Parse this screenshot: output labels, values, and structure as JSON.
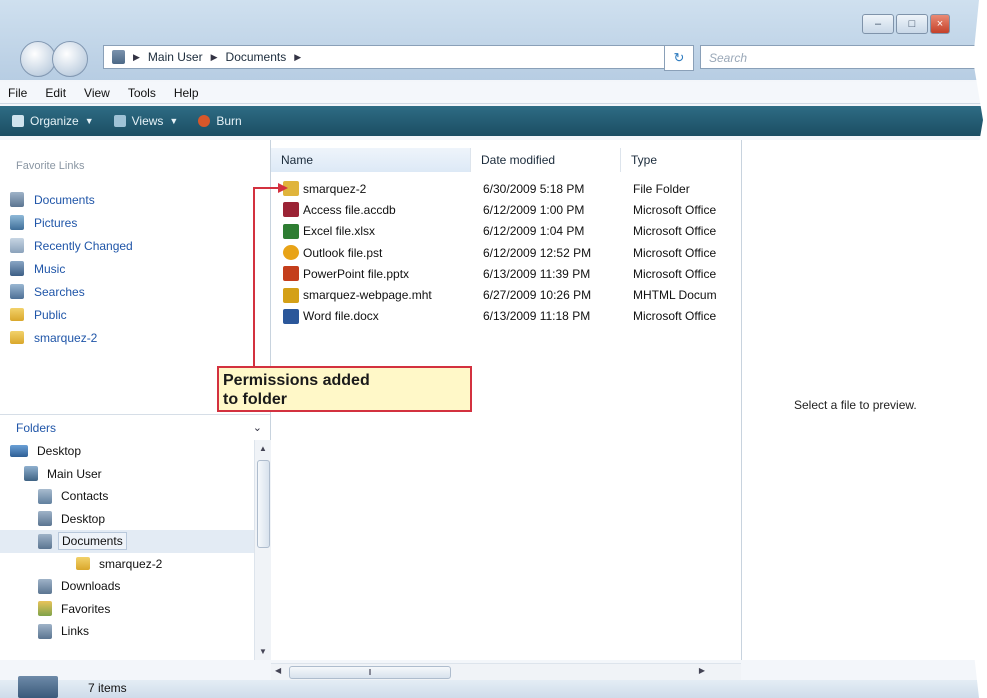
{
  "window": {
    "caption_buttons": [
      "minimize",
      "maximize",
      "close"
    ]
  },
  "address_bar": {
    "crumbs": [
      "Main User",
      "Documents"
    ]
  },
  "search": {
    "placeholder": "Search"
  },
  "menu": [
    "File",
    "Edit",
    "View",
    "Tools",
    "Help"
  ],
  "toolbar": {
    "organize": "Organize",
    "views": "Views",
    "burn": "Burn"
  },
  "sidebar": {
    "favorite_header": "Favorite Links",
    "favorites": [
      {
        "label": "Documents",
        "icon": "documents-icon"
      },
      {
        "label": "Pictures",
        "icon": "pictures-icon"
      },
      {
        "label": "Recently Changed",
        "icon": "recently-changed-icon"
      },
      {
        "label": "Music",
        "icon": "music-icon"
      },
      {
        "label": "Searches",
        "icon": "searches-icon"
      },
      {
        "label": "Public",
        "icon": "folder-icon"
      },
      {
        "label": "smarquez-2",
        "icon": "folder-icon"
      }
    ],
    "folders_header": "Folders",
    "tree": [
      {
        "label": "Desktop",
        "level": 0
      },
      {
        "label": "Main User",
        "level": 1
      },
      {
        "label": "Contacts",
        "level": 2
      },
      {
        "label": "Desktop",
        "level": 2
      },
      {
        "label": "Documents",
        "level": 2,
        "selected": true
      },
      {
        "label": "smarquez-2",
        "level": 3
      },
      {
        "label": "Downloads",
        "level": 2
      },
      {
        "label": "Favorites",
        "level": 2
      },
      {
        "label": "Links",
        "level": 2
      }
    ]
  },
  "list": {
    "columns": [
      "Name",
      "Date modified",
      "Type"
    ],
    "rows": [
      {
        "name": "smarquez-2",
        "date": "6/30/2009 5:18 PM",
        "type": "File Folder",
        "icon": "folder-icon",
        "color": "#e0b43c"
      },
      {
        "name": "Access file.accdb",
        "date": "6/12/2009 1:00 PM",
        "type": "Microsoft Office",
        "icon": "access-icon",
        "color": "#9b2335"
      },
      {
        "name": "Excel file.xlsx",
        "date": "6/12/2009 1:04 PM",
        "type": "Microsoft Office",
        "icon": "excel-icon",
        "color": "#2e7d32"
      },
      {
        "name": "Outlook file.pst",
        "date": "6/12/2009 12:52 PM",
        "type": "Microsoft Office",
        "icon": "outlook-icon",
        "color": "#e8a317"
      },
      {
        "name": "PowerPoint file.pptx",
        "date": "6/13/2009 11:39 PM",
        "type": "Microsoft Office",
        "icon": "powerpoint-icon",
        "color": "#c43e1c"
      },
      {
        "name": "smarquez-webpage.mht",
        "date": "6/27/2009 10:26 PM",
        "type": "MHTML Docum",
        "icon": "mhtml-icon",
        "color": "#d4a017"
      },
      {
        "name": "Word file.docx",
        "date": "6/13/2009 11:18 PM",
        "type": "Microsoft Office",
        "icon": "word-icon",
        "color": "#2b579a"
      }
    ]
  },
  "preview": {
    "message": "Select a file to preview."
  },
  "status": {
    "count": "7 items"
  },
  "callout": {
    "line1": "Permissions added",
    "line2": "to folder"
  },
  "colors": {
    "toolbar": "#1b4e63",
    "callout_border": "#d3313f",
    "callout_fill": "#fff8c8",
    "link_blue": "#1f55a8"
  }
}
